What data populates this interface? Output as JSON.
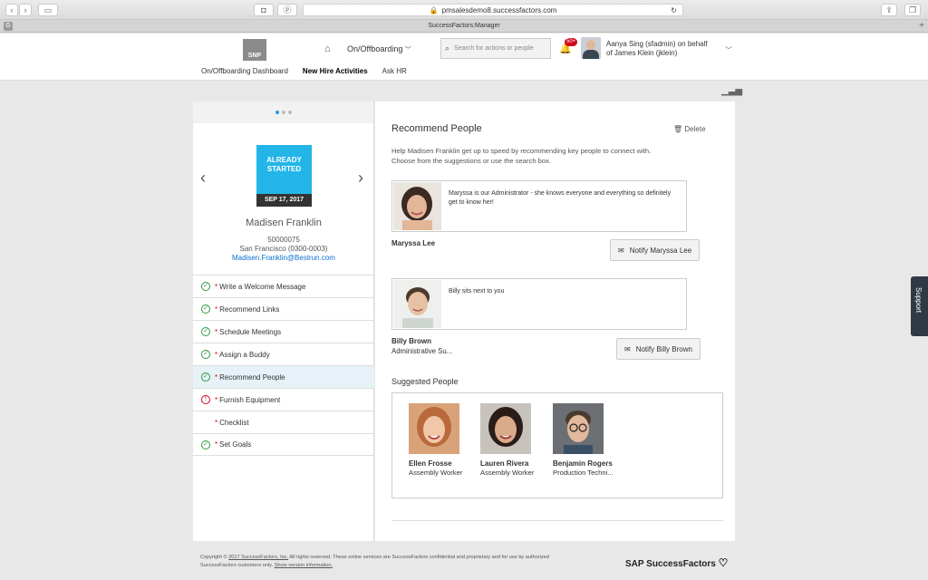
{
  "browser": {
    "url": "pmsalesdemo8.successfactors.com",
    "tab_title": "SuccessFactors:Manager"
  },
  "header": {
    "logo_text": "SNP",
    "module": "On/Offboarding",
    "search_placeholder": "Search for actions or people",
    "notif_count": "50+",
    "user_line1": "Aanya Sing (sfadmin) on behalf",
    "user_line2": "of James Klein (jklein)"
  },
  "subnav": {
    "dashboard": "On/Offboarding Dashboard",
    "new_hire": "New Hire Activities",
    "ask_hr": "Ask HR"
  },
  "new_hire": {
    "status_line1": "ALREADY",
    "status_line2": "STARTED",
    "date": "SEP 17, 2017",
    "name": "Madisen Franklin",
    "id": "50000075",
    "location": "San Francisco (0300-0003)",
    "email": "Madisen.Franklin@Bestrun.com"
  },
  "steps": [
    {
      "label": "Write a Welcome Message",
      "status": "done"
    },
    {
      "label": "Recommend Links",
      "status": "done"
    },
    {
      "label": "Schedule Meetings",
      "status": "done"
    },
    {
      "label": "Assign a Buddy",
      "status": "done"
    },
    {
      "label": "Recommend People",
      "status": "done"
    },
    {
      "label": "Furnish Equipment",
      "status": "error"
    },
    {
      "label": "Checklist",
      "status": "none"
    },
    {
      "label": "Set Goals",
      "status": "done"
    }
  ],
  "main": {
    "title": "Recommend People",
    "delete_label": "Delete",
    "help_line1": "Help Madisen Franklin get up to speed by recommending key people to connect with.",
    "help_line2": "Choose from the suggestions or use the search box.",
    "recommended": [
      {
        "name": "Maryssa Lee",
        "subtitle": "",
        "note": "Maryssa is our Administrator - she knows everyone and everything so definitely get to know her!",
        "notify_label": "Notify Maryssa Lee"
      },
      {
        "name": "Billy Brown",
        "subtitle": "Administrative Su...",
        "note": "Billy sits next to you",
        "notify_label": "Notify Billy Brown"
      }
    ],
    "suggested_title": "Suggested People",
    "suggested": [
      {
        "name": "Ellen Frosse",
        "role": "Assembly Worker"
      },
      {
        "name": "Lauren Rivera",
        "role": "Assembly Worker"
      },
      {
        "name": "Benjamin Rogers",
        "role": "Production Techni..."
      }
    ]
  },
  "footer": {
    "copyright_prefix": "Copyright © ",
    "copyright_link": "2017 SuccessFactors, Inc.",
    "copyright_rest": " All rights reserved. These online services are SuccessFactors confidential and proprietary and for use by authorized",
    "line2": "SuccessFactors customers only. ",
    "version_link": "Show version information.",
    "brand": "SAP SuccessFactors"
  },
  "support_label": "Support",
  "colors": {
    "accent": "#23b5e8",
    "link": "#0a6ed1",
    "success": "#2b9a3e",
    "error": "#d0021b"
  }
}
